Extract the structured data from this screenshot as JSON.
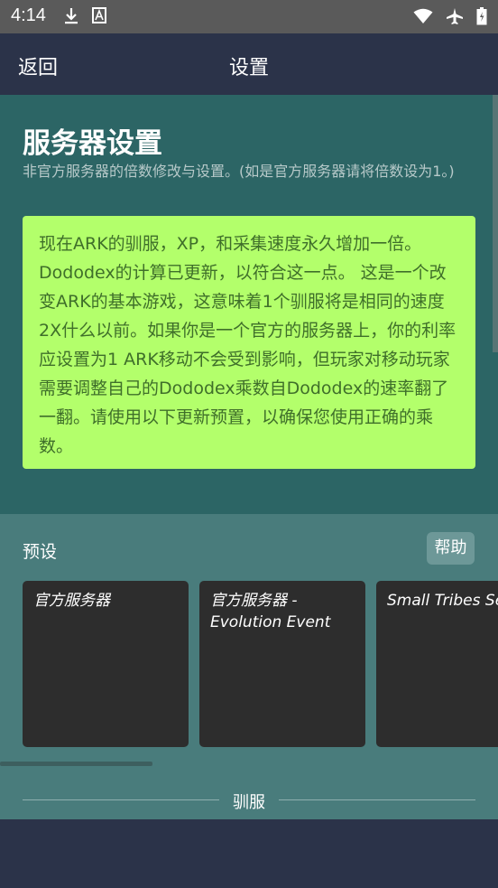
{
  "status_bar": {
    "time": "4:14",
    "left_icons": [
      "download-icon",
      "font-app-icon"
    ],
    "right_icons": [
      "wifi-icon",
      "airplane-icon",
      "battery-icon"
    ]
  },
  "app_bar": {
    "back_label": "返回",
    "title": "设置"
  },
  "server_settings": {
    "title": "服务器设置",
    "subtitle": "非官方服务器的倍数修改与设置。(如是官方服务器请将倍数设为1。)",
    "info_text": "现在ARK的驯服，XP，和采集速度永久增加一倍。 Dododex的计算已更新，以符合这一点。 这是一个改变ARK的基本游戏，这意味着1个驯服将是相同的速度2X什么以前。如果你是一个官方的服务器上，你的利率应设置为1 ARK移动不会受到影响，但玩家对移动玩家需要调整自己的Dododex乘数自Dododex的速率翻了一翻。请使用以下更新预置，以确保您使用正确的乘数。"
  },
  "presets": {
    "label": "预设",
    "help_label": "帮助",
    "cards": [
      {
        "name": "官方服务器"
      },
      {
        "name": "官方服务器 - Evolution Event"
      },
      {
        "name": "Small Tribes Se"
      }
    ]
  },
  "divider": {
    "label": "驯服"
  },
  "colors": {
    "app_bar": "#2b3349",
    "server_section": "#2c6565",
    "presets_section": "#497c7c",
    "info_box": "#b3ff6b",
    "card": "#2d2d2d"
  }
}
